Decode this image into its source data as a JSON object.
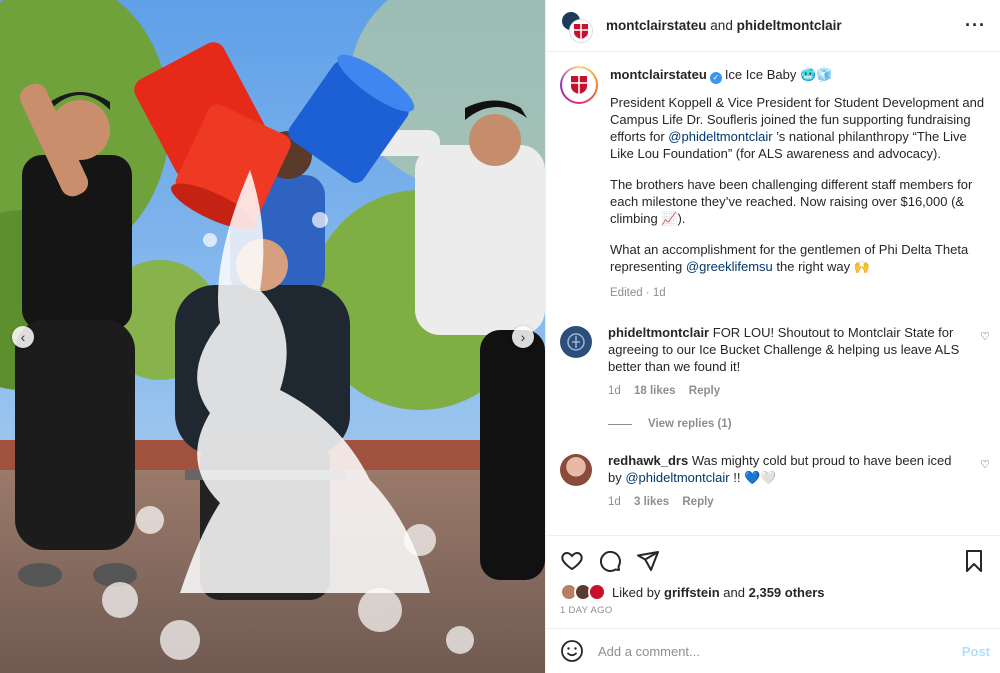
{
  "header": {
    "user1": "montclairstateu",
    "joiner": "and",
    "user2": "phideltmontclair",
    "more_icon": "more-horizontal-icon"
  },
  "caption": {
    "username": "montclairstateu",
    "title": "Ice Ice Baby 🥶🧊",
    "p1_pre": "President Koppell & Vice President for Student Development and Campus Life Dr. Soufleris joined the fun supporting fundraising efforts for ",
    "p1_mention": "@phideltmontclair",
    "p1_post": " ’s national philanthropy “The Live Like Lou Foundation” (for ALS awareness and advocacy).",
    "p2": "The brothers have been challenging different staff members for each milestone they’ve reached. Now raising over $16,000 (& climbing 📈).",
    "p3_pre": "What an accomplishment for the gentlemen of Phi Delta Theta representing ",
    "p3_mention": "@greeklifemsu",
    "p3_post": " the right way 🙌",
    "meta": "Edited · 1d"
  },
  "comments": [
    {
      "username": "phideltmontclair",
      "text": "FOR LOU! Shoutout to Montclair State for agreeing to our Ice Bucket Challenge & helping us leave ALS better than we found it!",
      "age": "1d",
      "likes": "18 likes",
      "reply": "Reply"
    },
    {
      "username": "redhawk_drs",
      "text_pre": "Was mighty cold but proud to have been iced by ",
      "mention": "@phideltmontclair",
      "text_post": " !! 💙🤍",
      "age": "1d",
      "likes": "3 likes",
      "reply": "Reply"
    }
  ],
  "view_replies": "View replies (1)",
  "likes": {
    "prefix": "Liked by",
    "user": "griffstein",
    "joiner": "and",
    "count": "2,359 others"
  },
  "date": "1 DAY AGO",
  "add_comment": {
    "placeholder": "Add a comment...",
    "post_label": "Post"
  },
  "icons": {
    "carousel_left": "‹",
    "carousel_right": "›",
    "heart": "♡"
  }
}
